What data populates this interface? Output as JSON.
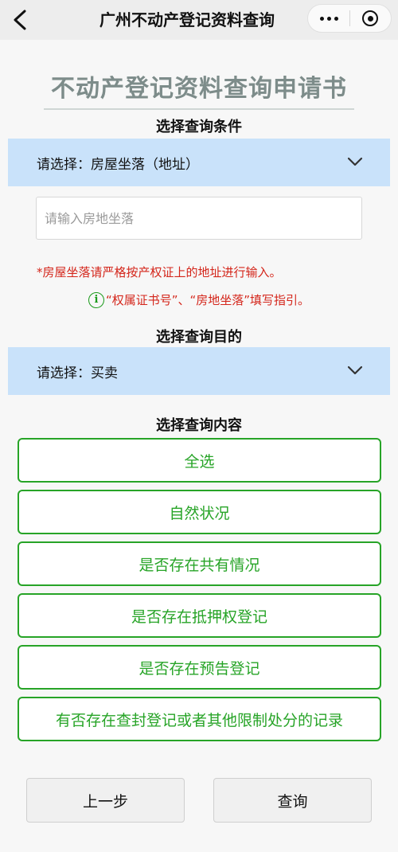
{
  "nav": {
    "title": "广州不动产登记资料查询"
  },
  "form": {
    "title": "不动产登记资料查询申请书",
    "condition_heading": "选择查询条件",
    "condition_select": "请选择：房屋坐落（地址）",
    "address_placeholder": "请输入房地坐落",
    "address_value": "",
    "warning": "*房屋坐落请严格按产权证上的地址进行输入。",
    "guide_icon": "info-icon",
    "guide_text": "“权属证书号”、“房地坐落”填写指引。",
    "purpose_heading": "选择查询目的",
    "purpose_select": "请选择：买卖",
    "content_heading": "选择查询内容",
    "options": [
      "全选",
      "自然状况",
      "是否存在共有情况",
      "是否存在抵押权登记",
      "是否存在预告登记",
      "有否存在查封登记或者其他限制处分的记录"
    ],
    "prev_label": "上一步",
    "query_label": "查询"
  },
  "colors": {
    "accent_green": "#27a427",
    "select_bg": "#c9e2fa",
    "warning_red": "#d4261b",
    "title_gray": "#7d8c8a"
  }
}
